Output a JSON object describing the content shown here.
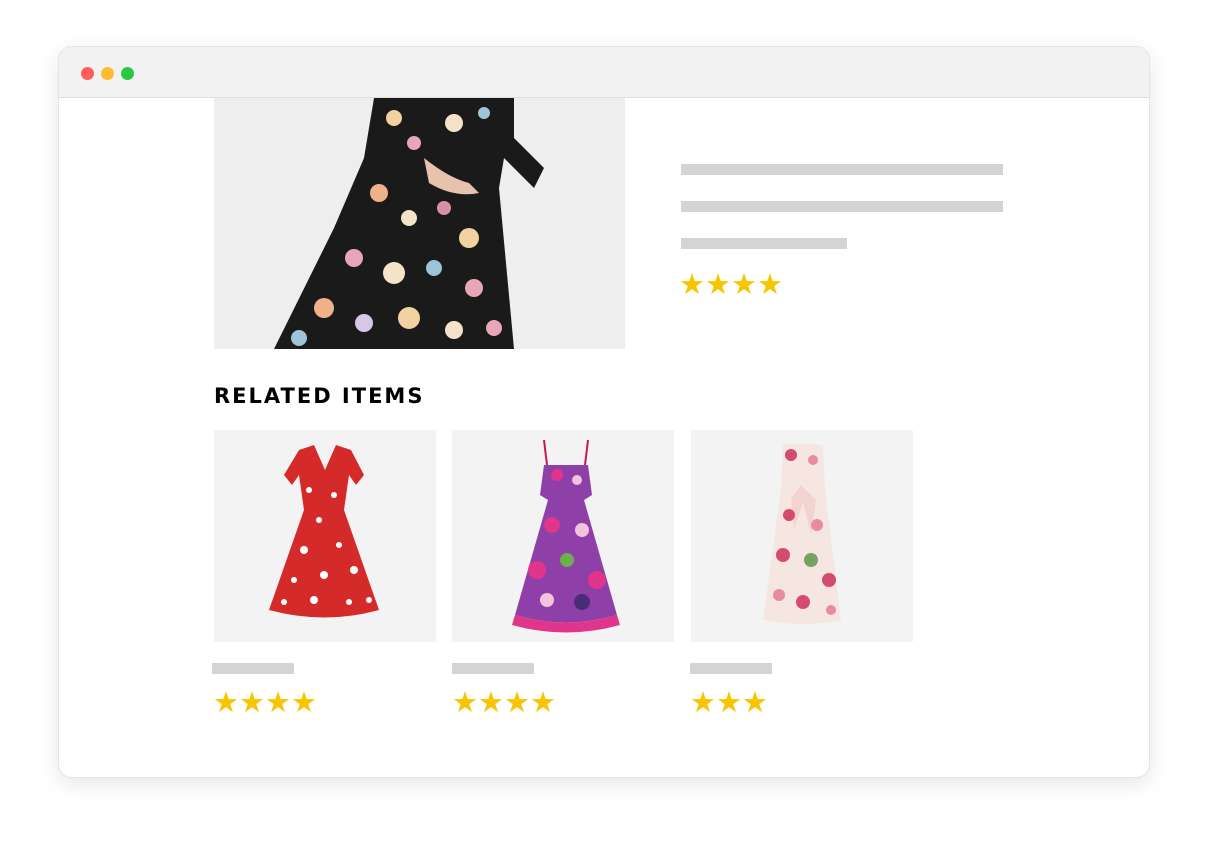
{
  "window": {
    "controls": {
      "close_color": "#ff5f57",
      "minimize_color": "#febc2e",
      "maximize_color": "#28c840"
    }
  },
  "product": {
    "image_icon": "floral-dress-photo",
    "rating": 4,
    "stars_text": "★★★★"
  },
  "related": {
    "title": "RELATED ITEMS",
    "items": [
      {
        "image_icon": "red-floral-dress-photo",
        "rating": 4,
        "stars_text": "★★★★"
      },
      {
        "image_icon": "pink-purple-floral-dress-photo",
        "rating": 4,
        "stars_text": "★★★★"
      },
      {
        "image_icon": "rose-print-strapless-dress-photo",
        "rating": 3,
        "stars_text": "★★★"
      }
    ]
  },
  "colors": {
    "star": "#f7c600",
    "placeholder_bar": "#d4d4d4"
  }
}
